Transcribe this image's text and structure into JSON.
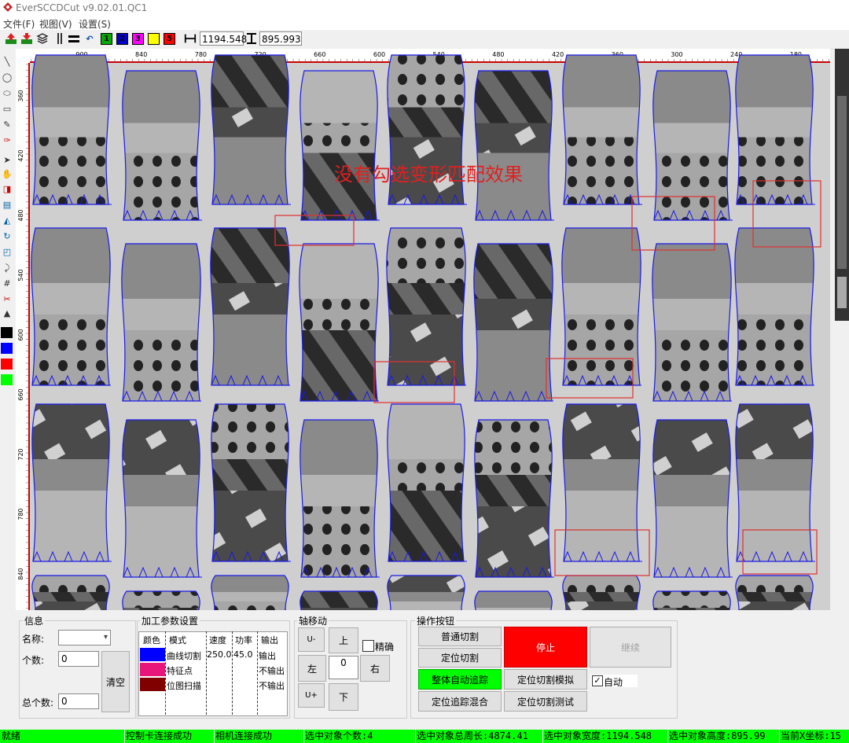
{
  "app": {
    "title": "EverSCCDCut v9.02.01.QC1"
  },
  "menu": [
    "文件(F)",
    "视图(V)",
    "设置(S)"
  ],
  "toolbar": {
    "number_buttons": [
      {
        "label": "1",
        "color": "#00aa00"
      },
      {
        "label": "2",
        "color": "#0000cc"
      },
      {
        "label": "3",
        "color": "#ff00ff"
      },
      {
        "label": "4",
        "color": "#ffff00"
      },
      {
        "label": "5",
        "color": "#ff0000"
      }
    ],
    "width_value": "1194.548",
    "height_value": "895.993"
  },
  "ruler": {
    "top_ticks": [
      "900",
      "840",
      "780",
      "720",
      "660",
      "600",
      "540",
      "480",
      "420",
      "360",
      "300",
      "240",
      "180"
    ],
    "left_ticks": [
      "360",
      "420",
      "480",
      "540",
      "600",
      "660",
      "720",
      "780",
      "840"
    ]
  },
  "canvas": {
    "overlay_text": "没有勾选变形匹配效果"
  },
  "left_palette": [
    "#000000",
    "#0000ff",
    "#ff0000",
    "#00ff00"
  ],
  "info_panel": {
    "title": "信息",
    "name_label": "名称:",
    "name_value": "",
    "count_label": "个数:",
    "count_value": "0",
    "total_label": "总个数:",
    "total_value": "0",
    "clear_button": "清空"
  },
  "params_panel": {
    "title": "加工参数设置",
    "headers": [
      "颜色",
      "模式",
      "速度",
      "功率",
      "输出"
    ],
    "rows": [
      {
        "color": "#0000ff",
        "mode": "曲线切割",
        "speed": "250.0",
        "power": "45.0",
        "output": "输出"
      },
      {
        "color": "#e8157a",
        "mode": "特征点",
        "speed": "",
        "power": "",
        "output": "不输出"
      },
      {
        "color": "#800000",
        "mode": "位图扫描",
        "speed": "",
        "power": "",
        "output": "不输出"
      }
    ]
  },
  "axis_panel": {
    "title": "轴移动",
    "u_minus": "U-",
    "up": "上",
    "precise_label": "精确",
    "left": "左",
    "step_value": "0",
    "right": "右",
    "u_plus": "U+",
    "down": "下"
  },
  "ops_panel": {
    "title": "操作按钮",
    "normal_cut": "普通切割",
    "stop": "停止",
    "resume": "继续",
    "locate_cut": "定位切割",
    "auto_track": "整体自动追踪",
    "locate_sim": "定位切割模拟",
    "auto_label": "自动",
    "locate_track_mix": "定位追踪混合",
    "locate_test": "定位切割测试"
  },
  "status": [
    "就绪",
    "控制卡连接成功",
    "相机连接成功",
    "选中对象个数:4",
    "选中对象总周长:4874.41",
    "选中对象宽度:1194.548",
    "选中对象高度:895.99",
    "当前X坐标:15"
  ]
}
